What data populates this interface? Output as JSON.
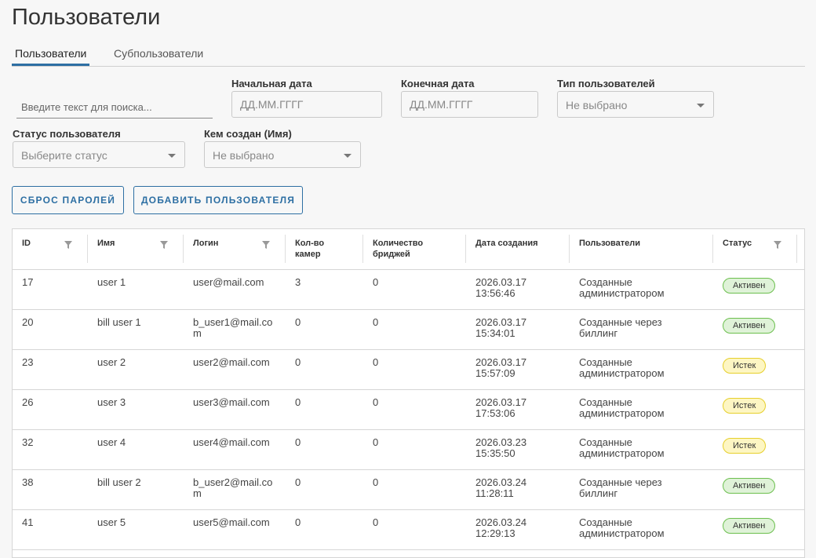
{
  "page": {
    "title": "Пользователи"
  },
  "tabs": [
    {
      "label": "Пользователи",
      "active": true
    },
    {
      "label": "Субпользователи",
      "active": false
    }
  ],
  "filters": {
    "search_placeholder": "Введите текст для поиска...",
    "start_date": {
      "label": "Начальная дата",
      "placeholder": "ДД.ММ.ГГГГ"
    },
    "end_date": {
      "label": "Конечная дата",
      "placeholder": "ДД.ММ.ГГГГ"
    },
    "user_type": {
      "label": "Тип пользователей",
      "value": "Не выбрано"
    },
    "user_status": {
      "label": "Статус пользователя",
      "value": "Выберите статус"
    },
    "created_by": {
      "label": "Кем создан (Имя)",
      "value": "Не выбрано"
    }
  },
  "buttons": {
    "reset_passwords": "СБРОС ПАРОЛЕЙ",
    "add_user": "ДОБАВИТЬ ПОЛЬЗОВАТЕЛЯ"
  },
  "table": {
    "headers": {
      "id": "ID",
      "name": "Имя",
      "login": "Логин",
      "cameras_1": "Кол-во",
      "cameras_2": "камер",
      "bridges_1": "Количество",
      "bridges_2": "бриджей",
      "created": "Дата создания",
      "users": "Пользователи",
      "status": "Статус"
    },
    "rows": [
      {
        "id": "17",
        "name": "user 1",
        "login_1": "user@mail.com",
        "login_2": "",
        "cameras": "3",
        "bridges": "0",
        "date": "2026.03.17",
        "time": "13:56:46",
        "users_1": "Созданные",
        "users_2": "администратором",
        "status": "Активен",
        "status_kind": "active"
      },
      {
        "id": "20",
        "name": "bill user 1",
        "login_1": "b_user1@mail.co",
        "login_2": "m",
        "cameras": "0",
        "bridges": "0",
        "date": "2026.03.17",
        "time": "15:34:01",
        "users_1": "Созданные через",
        "users_2": "биллинг",
        "status": "Активен",
        "status_kind": "active"
      },
      {
        "id": "23",
        "name": "user 2",
        "login_1": "user2@mail.com",
        "login_2": "",
        "cameras": "0",
        "bridges": "0",
        "date": "2026.03.17",
        "time": "15:57:09",
        "users_1": "Созданные",
        "users_2": "администратором",
        "status": "Истек",
        "status_kind": "expired"
      },
      {
        "id": "26",
        "name": "user 3",
        "login_1": "user3@mail.com",
        "login_2": "",
        "cameras": "0",
        "bridges": "0",
        "date": "2026.03.17",
        "time": "17:53:06",
        "users_1": "Созданные",
        "users_2": "администратором",
        "status": "Истек",
        "status_kind": "expired"
      },
      {
        "id": "32",
        "name": "user 4",
        "login_1": "user4@mail.com",
        "login_2": "",
        "cameras": "0",
        "bridges": "0",
        "date": "2026.03.23",
        "time": "15:35:50",
        "users_1": "Созданные",
        "users_2": "администратором",
        "status": "Истек",
        "status_kind": "expired"
      },
      {
        "id": "38",
        "name": "bill user 2",
        "login_1": "b_user2@mail.co",
        "login_2": "m",
        "cameras": "0",
        "bridges": "0",
        "date": "2026.03.24",
        "time": "11:28:11",
        "users_1": "Созданные через",
        "users_2": "биллинг",
        "status": "Активен",
        "status_kind": "active"
      },
      {
        "id": "41",
        "name": "user 5",
        "login_1": "user5@mail.com",
        "login_2": "",
        "cameras": "0",
        "bridges": "0",
        "date": "2026.03.24",
        "time": "12:29:13",
        "users_1": "Созданные",
        "users_2": "администратором",
        "status": "Активен",
        "status_kind": "active"
      }
    ]
  },
  "colors": {
    "accent": "#2d6fa3",
    "active_bg": "#dff2d8",
    "active_border": "#6cbf4e",
    "expired_bg": "#fdf6c3",
    "expired_border": "#e6cf2b"
  },
  "icons": {
    "filter": "filter-funnel-icon",
    "dropdown": "chevron-down-icon"
  }
}
